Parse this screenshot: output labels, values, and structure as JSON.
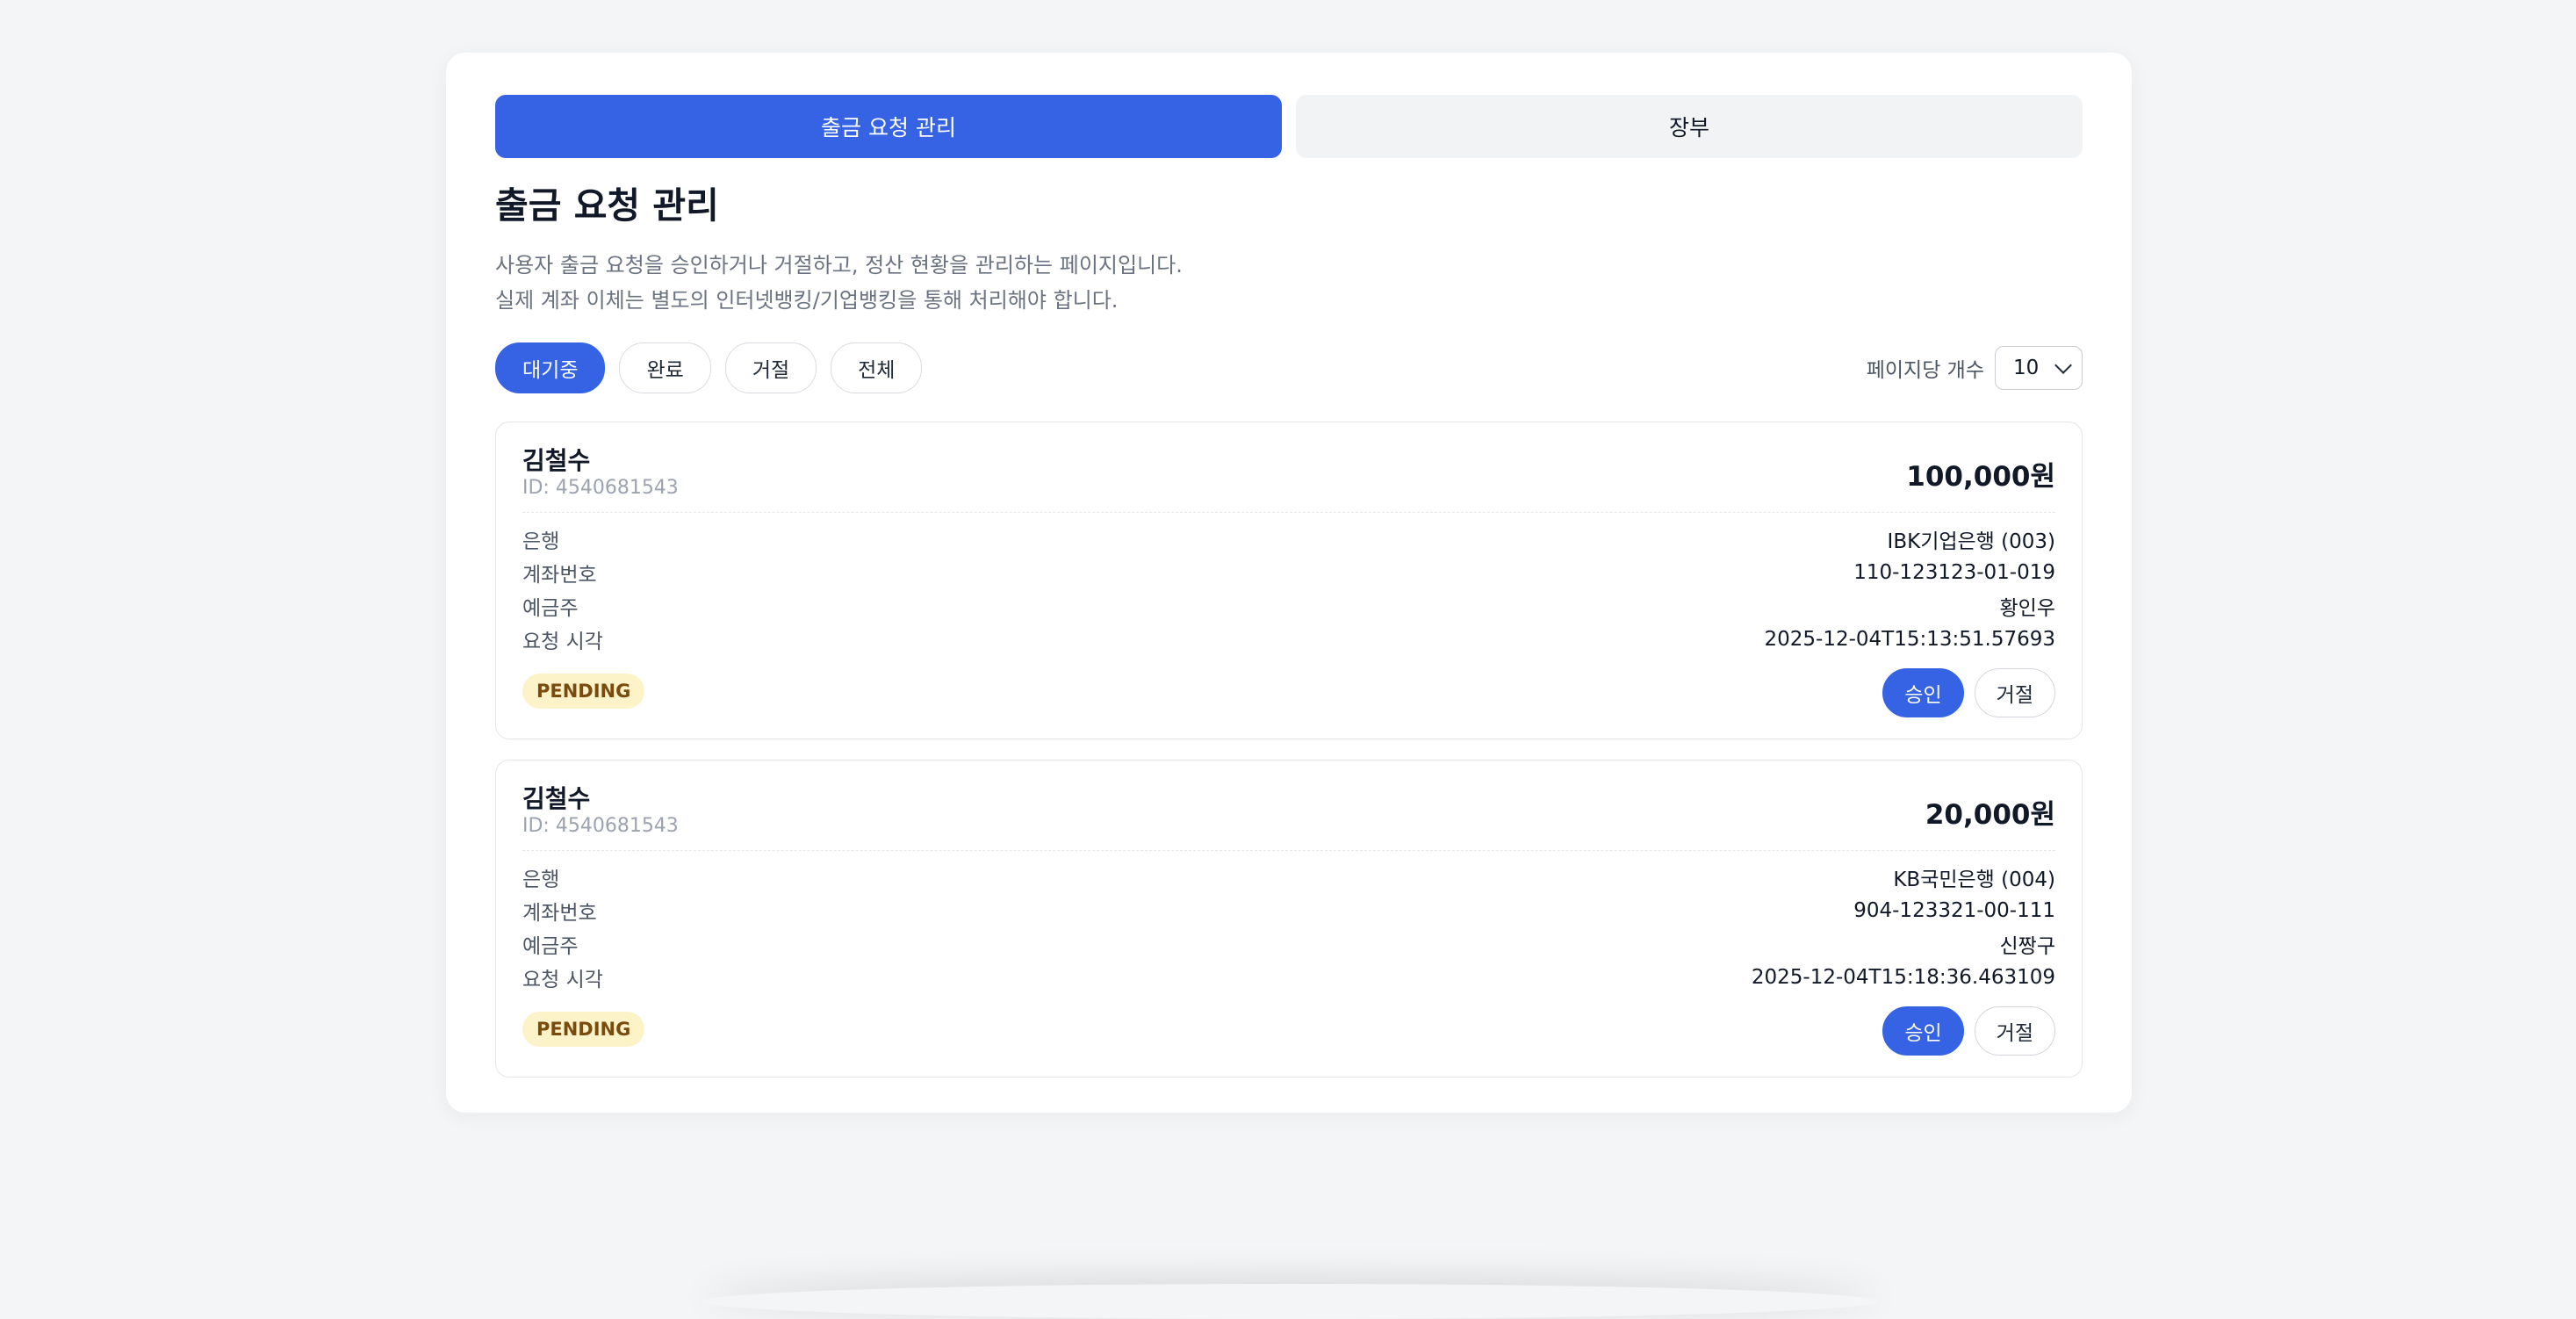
{
  "tabs": [
    {
      "label": "출금 요청 관리",
      "active": true
    },
    {
      "label": "장부",
      "active": false
    }
  ],
  "page": {
    "title": "출금 요청 관리",
    "description_line1": "사용자 출금 요청을 승인하거나 거절하고, 정산 현황을 관리하는 페이지입니다.",
    "description_line2": "실제 계좌 이체는 별도의 인터넷뱅킹/기업뱅킹을 통해 처리해야 합니다."
  },
  "filters": [
    {
      "label": "대기중",
      "active": true
    },
    {
      "label": "완료",
      "active": false
    },
    {
      "label": "거절",
      "active": false
    },
    {
      "label": "전체",
      "active": false
    }
  ],
  "page_size": {
    "label": "페이지당 개수",
    "value": "10"
  },
  "requests": [
    {
      "name": "김철수",
      "id_text": "ID: 4540681543",
      "amount": "100,000원",
      "fields": [
        {
          "key": "은행",
          "value": "IBK기업은행 (003)"
        },
        {
          "key": "계좌번호",
          "value": "110-123123-01-019"
        },
        {
          "key": "예금주",
          "value": "황인우"
        },
        {
          "key": "요청 시각",
          "value": "2025-12-04T15:13:51.57693"
        }
      ],
      "status": "PENDING",
      "approve_label": "승인",
      "reject_label": "거절"
    },
    {
      "name": "김철수",
      "id_text": "ID: 4540681543",
      "amount": "20,000원",
      "fields": [
        {
          "key": "은행",
          "value": "KB국민은행 (004)"
        },
        {
          "key": "계좌번호",
          "value": "904-123321-00-111"
        },
        {
          "key": "예금주",
          "value": "신짱구"
        },
        {
          "key": "요청 시각",
          "value": "2025-12-04T15:18:36.463109"
        }
      ],
      "status": "PENDING",
      "approve_label": "승인",
      "reject_label": "거절"
    }
  ],
  "colors": {
    "accent": "#3563e3",
    "pending_badge_bg": "#fdf3c9",
    "pending_badge_text": "#7a4b0e"
  }
}
